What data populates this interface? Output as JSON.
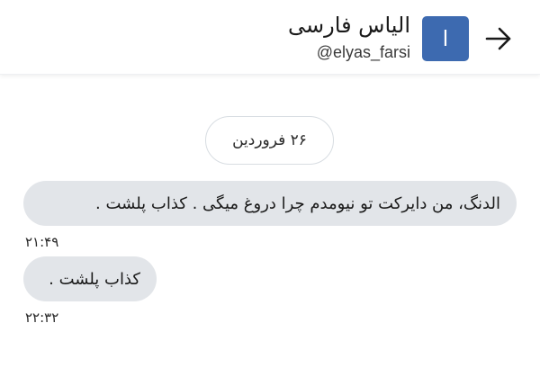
{
  "header": {
    "contact_name": "الیاس فارسی",
    "contact_handle": "@elyas_farsi",
    "avatar_letter": "ا",
    "avatar_color": "#3d6ab0",
    "back_icon": "arrow-right-icon"
  },
  "conversation": {
    "date_label": "۲۶ فروردین",
    "messages": [
      {
        "text": "الدنگ،  من دایرکت تو نیومدم چرا دروغ میگی . کذاب پلشت .",
        "time": "۲۱:۴۹"
      },
      {
        "text": "کذاب پلشت .",
        "time": "۲۲:۳۲"
      }
    ]
  },
  "colors": {
    "bubble": "#e2e5e9",
    "background": "#ffffff",
    "pill_border": "#d8dde2"
  }
}
